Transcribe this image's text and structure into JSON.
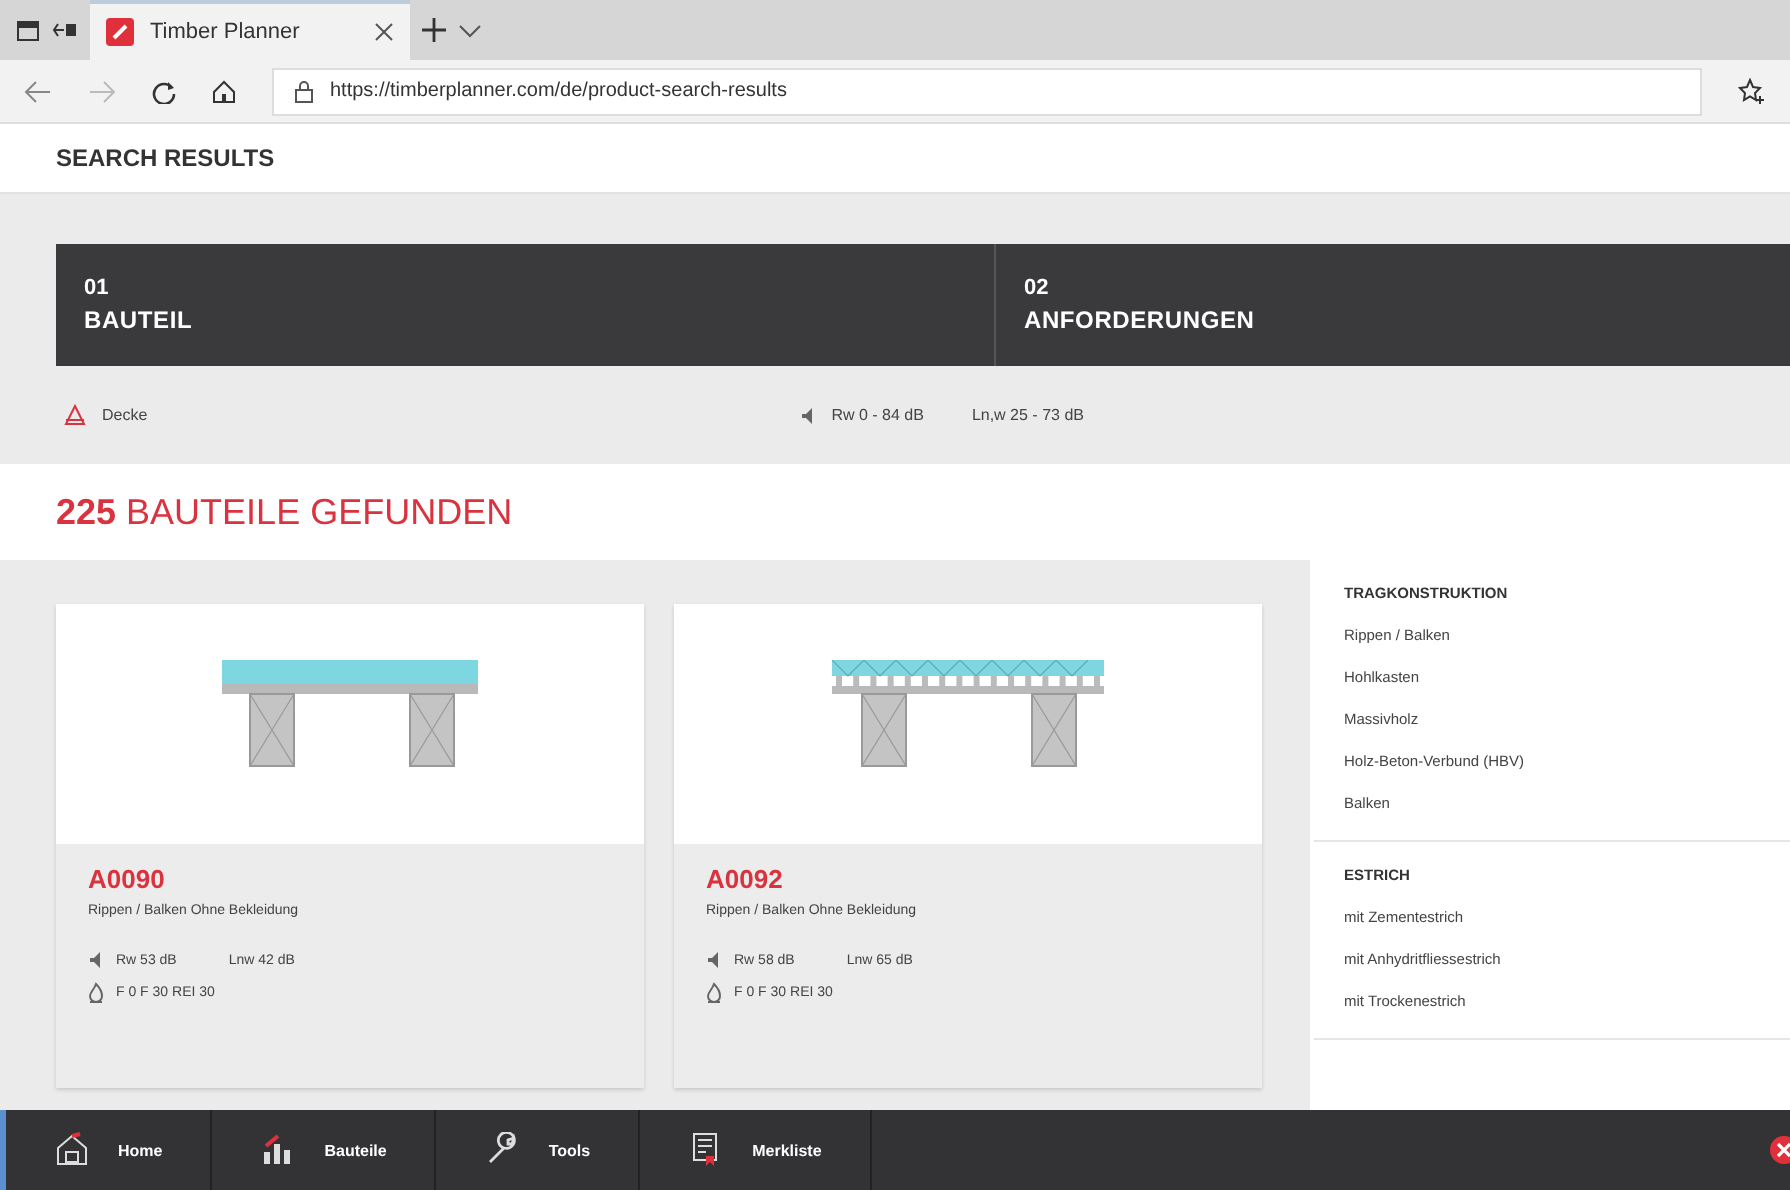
{
  "browser": {
    "tab_title": "Timber Planner",
    "url": "https://timberplanner.com/de/product-search-results"
  },
  "page_title": "SEARCH RESULTS",
  "steps": [
    {
      "number": "01",
      "label": "BAUTEIL"
    },
    {
      "number": "02",
      "label": "ANFORDERUNGEN"
    }
  ],
  "filters": {
    "component": "Decke",
    "rw": "Rw 0 - 84 dB",
    "lnw": "Ln,w 25 - 73 dB"
  },
  "results_heading": {
    "count": "225",
    "label": "BAUTEILE GEFUNDEN"
  },
  "cards": [
    {
      "code": "A0090",
      "description": "Rippen / Balken Ohne Bekleidung",
      "rw": "Rw 53 dB",
      "lnw": "Lnw 42 dB",
      "fire": "F 0 F 30 REI 30",
      "kind": "solid"
    },
    {
      "code": "A0092",
      "description": "Rippen / Balken Ohne Bekleidung",
      "rw": "Rw 58 dB",
      "lnw": "Lnw 65 dB",
      "fire": "F 0 F 30 REI 30",
      "kind": "ribbed"
    }
  ],
  "sidebar": [
    {
      "heading": "TRAGKONSTRUKTION",
      "items": [
        "Rippen / Balken",
        "Hohlkasten",
        "Massivholz",
        "Holz-Beton-Verbund (HBV)",
        "Balken"
      ]
    },
    {
      "heading": "ESTRICH",
      "items": [
        "mit Zementestrich",
        "mit Anhydritfliessestrich",
        "mit Trockenestrich"
      ]
    }
  ],
  "nav": [
    {
      "label": "Home"
    },
    {
      "label": "Bauteile"
    },
    {
      "label": "Tools"
    },
    {
      "label": "Merkliste"
    }
  ]
}
